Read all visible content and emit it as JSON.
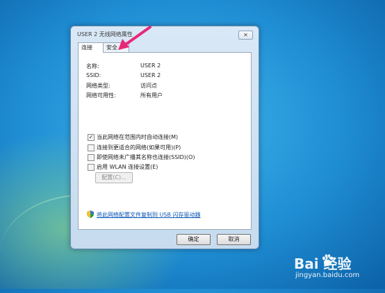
{
  "dialog": {
    "title": "USER 2 无线网络属性",
    "close_glyph": "✕",
    "tabs": [
      {
        "label": "连接",
        "active": true
      },
      {
        "label": "安全",
        "active": false
      }
    ],
    "info": [
      {
        "label": "名称:",
        "value": "USER 2"
      },
      {
        "label": "SSID:",
        "value": "USER 2"
      },
      {
        "label": "网络类型:",
        "value": "访问点"
      },
      {
        "label": "网络可用性:",
        "value": "所有用户"
      }
    ],
    "options": [
      {
        "label": "当此网络在范围内时自动连接(M)",
        "checked": true
      },
      {
        "label": "连接到更适合的网络(如果可用)(P)",
        "checked": false
      },
      {
        "label": "即使网络未广播其名称也连接(SSID)(O)",
        "checked": false
      },
      {
        "label": "启用 WLAN 连接设置(E)",
        "checked": false
      }
    ],
    "check_mark": "✓",
    "advanced_button": "配置(C)...",
    "copy_link": "将此网络配置文件复制到 USB 闪存驱动器",
    "ok_button": "确定",
    "cancel_button": "取消"
  },
  "watermark": {
    "brand": "Bai  经验",
    "url": "jingyan.baidu.com"
  },
  "colors": {
    "arrow": "#e8277a",
    "link": "#0a55b5"
  }
}
